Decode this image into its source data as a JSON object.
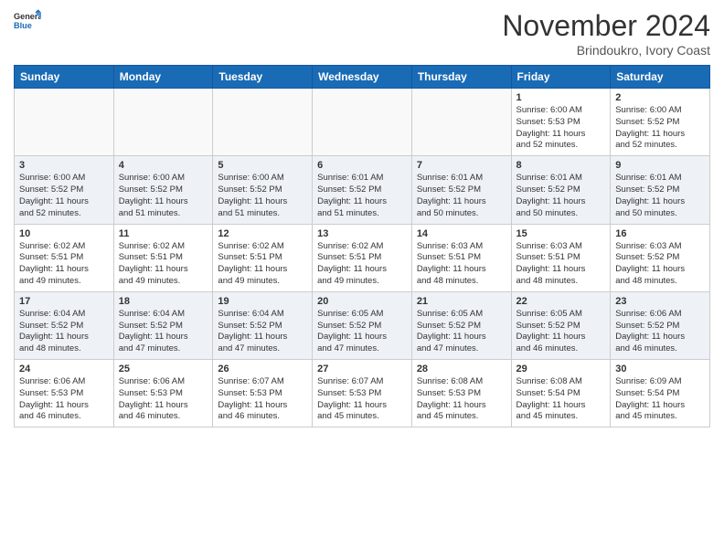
{
  "header": {
    "logo_line1": "General",
    "logo_line2": "Blue",
    "month": "November 2024",
    "location": "Brindoukro, Ivory Coast"
  },
  "weekdays": [
    "Sunday",
    "Monday",
    "Tuesday",
    "Wednesday",
    "Thursday",
    "Friday",
    "Saturday"
  ],
  "weeks": [
    [
      {
        "day": "",
        "info": ""
      },
      {
        "day": "",
        "info": ""
      },
      {
        "day": "",
        "info": ""
      },
      {
        "day": "",
        "info": ""
      },
      {
        "day": "",
        "info": ""
      },
      {
        "day": "1",
        "info": "Sunrise: 6:00 AM\nSunset: 5:53 PM\nDaylight: 11 hours\nand 52 minutes."
      },
      {
        "day": "2",
        "info": "Sunrise: 6:00 AM\nSunset: 5:52 PM\nDaylight: 11 hours\nand 52 minutes."
      }
    ],
    [
      {
        "day": "3",
        "info": "Sunrise: 6:00 AM\nSunset: 5:52 PM\nDaylight: 11 hours\nand 52 minutes."
      },
      {
        "day": "4",
        "info": "Sunrise: 6:00 AM\nSunset: 5:52 PM\nDaylight: 11 hours\nand 51 minutes."
      },
      {
        "day": "5",
        "info": "Sunrise: 6:00 AM\nSunset: 5:52 PM\nDaylight: 11 hours\nand 51 minutes."
      },
      {
        "day": "6",
        "info": "Sunrise: 6:01 AM\nSunset: 5:52 PM\nDaylight: 11 hours\nand 51 minutes."
      },
      {
        "day": "7",
        "info": "Sunrise: 6:01 AM\nSunset: 5:52 PM\nDaylight: 11 hours\nand 50 minutes."
      },
      {
        "day": "8",
        "info": "Sunrise: 6:01 AM\nSunset: 5:52 PM\nDaylight: 11 hours\nand 50 minutes."
      },
      {
        "day": "9",
        "info": "Sunrise: 6:01 AM\nSunset: 5:52 PM\nDaylight: 11 hours\nand 50 minutes."
      }
    ],
    [
      {
        "day": "10",
        "info": "Sunrise: 6:02 AM\nSunset: 5:51 PM\nDaylight: 11 hours\nand 49 minutes."
      },
      {
        "day": "11",
        "info": "Sunrise: 6:02 AM\nSunset: 5:51 PM\nDaylight: 11 hours\nand 49 minutes."
      },
      {
        "day": "12",
        "info": "Sunrise: 6:02 AM\nSunset: 5:51 PM\nDaylight: 11 hours\nand 49 minutes."
      },
      {
        "day": "13",
        "info": "Sunrise: 6:02 AM\nSunset: 5:51 PM\nDaylight: 11 hours\nand 49 minutes."
      },
      {
        "day": "14",
        "info": "Sunrise: 6:03 AM\nSunset: 5:51 PM\nDaylight: 11 hours\nand 48 minutes."
      },
      {
        "day": "15",
        "info": "Sunrise: 6:03 AM\nSunset: 5:51 PM\nDaylight: 11 hours\nand 48 minutes."
      },
      {
        "day": "16",
        "info": "Sunrise: 6:03 AM\nSunset: 5:52 PM\nDaylight: 11 hours\nand 48 minutes."
      }
    ],
    [
      {
        "day": "17",
        "info": "Sunrise: 6:04 AM\nSunset: 5:52 PM\nDaylight: 11 hours\nand 48 minutes."
      },
      {
        "day": "18",
        "info": "Sunrise: 6:04 AM\nSunset: 5:52 PM\nDaylight: 11 hours\nand 47 minutes."
      },
      {
        "day": "19",
        "info": "Sunrise: 6:04 AM\nSunset: 5:52 PM\nDaylight: 11 hours\nand 47 minutes."
      },
      {
        "day": "20",
        "info": "Sunrise: 6:05 AM\nSunset: 5:52 PM\nDaylight: 11 hours\nand 47 minutes."
      },
      {
        "day": "21",
        "info": "Sunrise: 6:05 AM\nSunset: 5:52 PM\nDaylight: 11 hours\nand 47 minutes."
      },
      {
        "day": "22",
        "info": "Sunrise: 6:05 AM\nSunset: 5:52 PM\nDaylight: 11 hours\nand 46 minutes."
      },
      {
        "day": "23",
        "info": "Sunrise: 6:06 AM\nSunset: 5:52 PM\nDaylight: 11 hours\nand 46 minutes."
      }
    ],
    [
      {
        "day": "24",
        "info": "Sunrise: 6:06 AM\nSunset: 5:53 PM\nDaylight: 11 hours\nand 46 minutes."
      },
      {
        "day": "25",
        "info": "Sunrise: 6:06 AM\nSunset: 5:53 PM\nDaylight: 11 hours\nand 46 minutes."
      },
      {
        "day": "26",
        "info": "Sunrise: 6:07 AM\nSunset: 5:53 PM\nDaylight: 11 hours\nand 46 minutes."
      },
      {
        "day": "27",
        "info": "Sunrise: 6:07 AM\nSunset: 5:53 PM\nDaylight: 11 hours\nand 45 minutes."
      },
      {
        "day": "28",
        "info": "Sunrise: 6:08 AM\nSunset: 5:53 PM\nDaylight: 11 hours\nand 45 minutes."
      },
      {
        "day": "29",
        "info": "Sunrise: 6:08 AM\nSunset: 5:54 PM\nDaylight: 11 hours\nand 45 minutes."
      },
      {
        "day": "30",
        "info": "Sunrise: 6:09 AM\nSunset: 5:54 PM\nDaylight: 11 hours\nand 45 minutes."
      }
    ]
  ]
}
